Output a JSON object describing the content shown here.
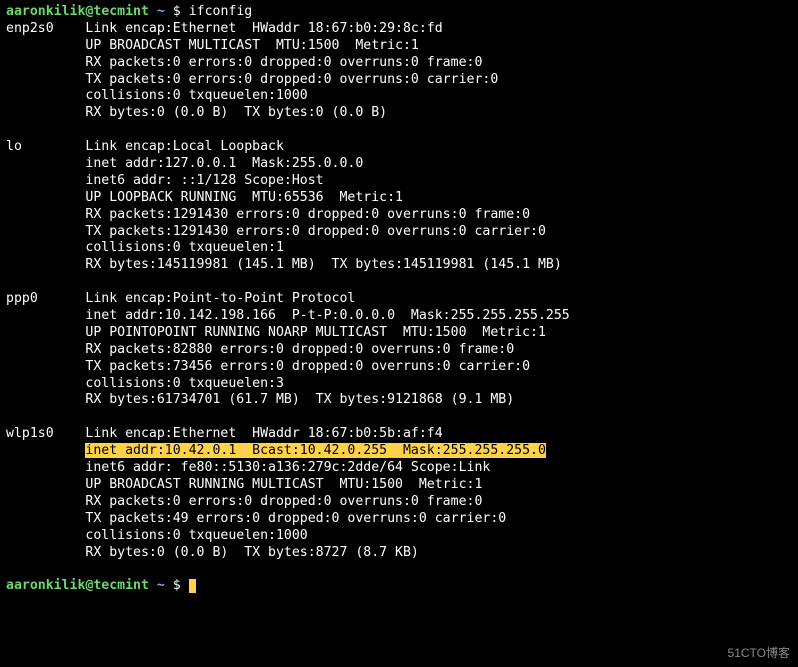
{
  "prompt": {
    "user": "aaronkilik",
    "at": "@",
    "host": "tecmint",
    "path": "~",
    "dollar": "$",
    "command": "ifconfig"
  },
  "interfaces": [
    {
      "name": "enp2s0",
      "lines": [
        "Link encap:Ethernet  HWaddr 18:67:b0:29:8c:fd",
        "UP BROADCAST MULTICAST  MTU:1500  Metric:1",
        "RX packets:0 errors:0 dropped:0 overruns:0 frame:0",
        "TX packets:0 errors:0 dropped:0 overruns:0 carrier:0",
        "collisions:0 txqueuelen:1000",
        "RX bytes:0 (0.0 B)  TX bytes:0 (0.0 B)"
      ],
      "highlight_index": -1
    },
    {
      "name": "lo",
      "lines": [
        "Link encap:Local Loopback",
        "inet addr:127.0.0.1  Mask:255.0.0.0",
        "inet6 addr: ::1/128 Scope:Host",
        "UP LOOPBACK RUNNING  MTU:65536  Metric:1",
        "RX packets:1291430 errors:0 dropped:0 overruns:0 frame:0",
        "TX packets:1291430 errors:0 dropped:0 overruns:0 carrier:0",
        "collisions:0 txqueuelen:1",
        "RX bytes:145119981 (145.1 MB)  TX bytes:145119981 (145.1 MB)"
      ],
      "highlight_index": -1
    },
    {
      "name": "ppp0",
      "lines": [
        "Link encap:Point-to-Point Protocol",
        "inet addr:10.142.198.166  P-t-P:0.0.0.0  Mask:255.255.255.255",
        "UP POINTOPOINT RUNNING NOARP MULTICAST  MTU:1500  Metric:1",
        "RX packets:82880 errors:0 dropped:0 overruns:0 frame:0",
        "TX packets:73456 errors:0 dropped:0 overruns:0 carrier:0",
        "collisions:0 txqueuelen:3",
        "RX bytes:61734701 (61.7 MB)  TX bytes:9121868 (9.1 MB)"
      ],
      "highlight_index": -1
    },
    {
      "name": "wlp1s0",
      "lines": [
        "Link encap:Ethernet  HWaddr 18:67:b0:5b:af:f4",
        "inet addr:10.42.0.1  Bcast:10.42.0.255  Mask:255.255.255.0",
        "inet6 addr: fe80::5130:a136:279c:2dde/64 Scope:Link",
        "UP BROADCAST RUNNING MULTICAST  MTU:1500  Metric:1",
        "RX packets:0 errors:0 dropped:0 overruns:0 frame:0",
        "TX packets:49 errors:0 dropped:0 overruns:0 carrier:0",
        "collisions:0 txqueuelen:1000",
        "RX bytes:0 (0.0 B)  TX bytes:8727 (8.7 KB)"
      ],
      "highlight_index": 1
    }
  ],
  "indent": "          ",
  "watermark": "51CTO博客"
}
